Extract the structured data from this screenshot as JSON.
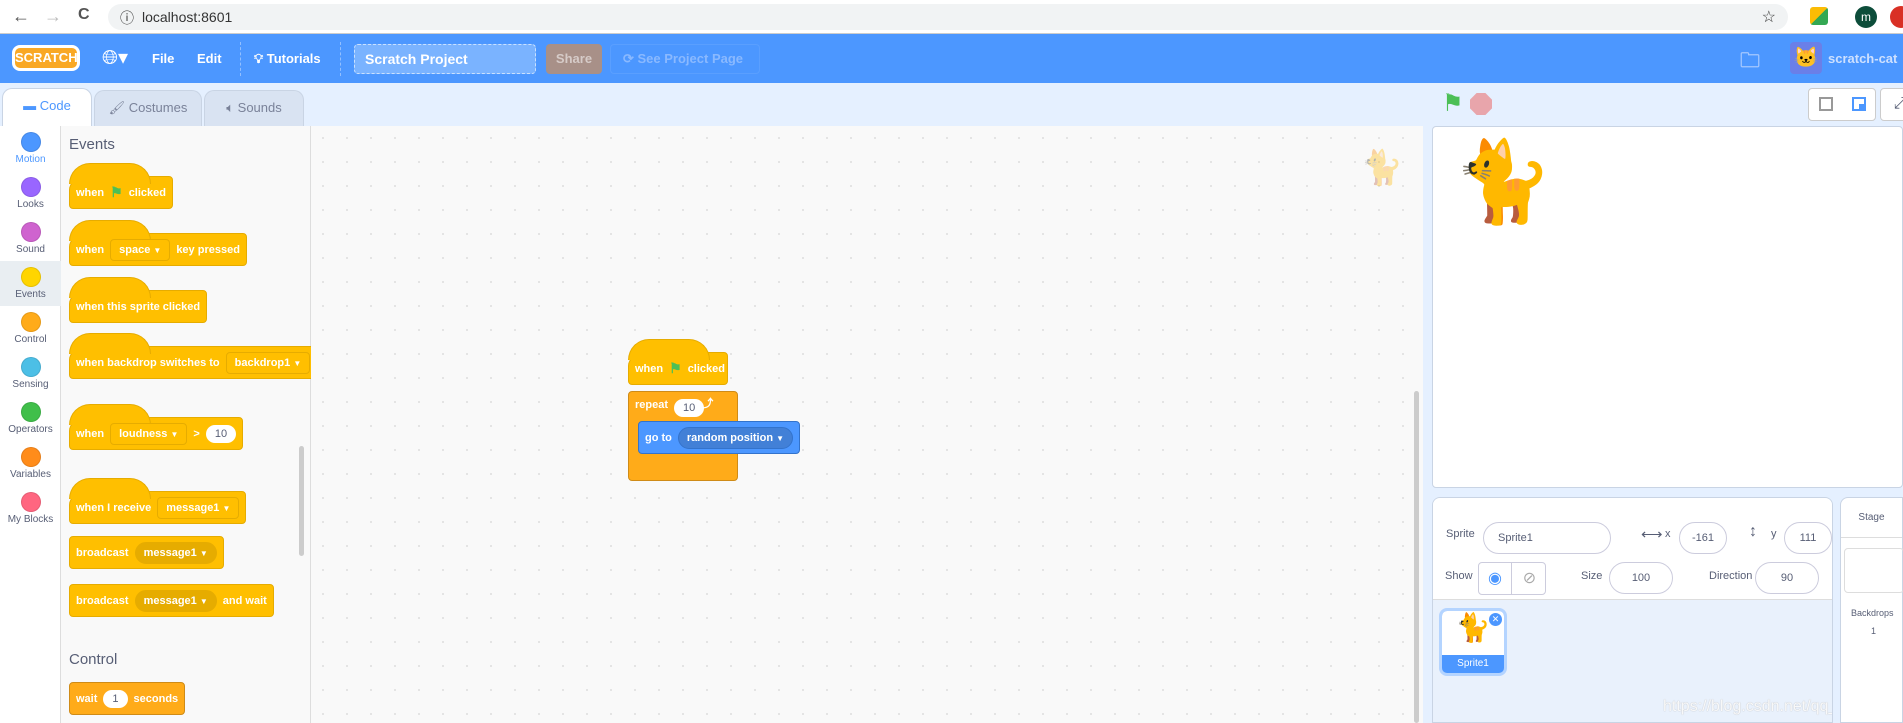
{
  "browser": {
    "url": "localhost:8601",
    "back": "←",
    "forward": "→",
    "reload": "C",
    "info": "ⓘ",
    "star": "☆",
    "profile": "m"
  },
  "menu": {
    "logo": "SCRATCH",
    "language_icon": "globe-icon",
    "file": "File",
    "edit": "Edit",
    "tutorials": "Tutorials",
    "project_title": "Scratch Project",
    "share": "Share",
    "see_project_page": "See Project Page",
    "username": "scratch-cat"
  },
  "tabs": [
    {
      "label": "Code",
      "active": true
    },
    {
      "label": "Costumes"
    },
    {
      "label": "Sounds"
    }
  ],
  "categories": [
    {
      "label": "Motion",
      "color": "#4c97ff"
    },
    {
      "label": "Looks",
      "color": "#9966ff"
    },
    {
      "label": "Sound",
      "color": "#cf63cf"
    },
    {
      "label": "Events",
      "color": "#ffd500",
      "selected": true
    },
    {
      "label": "Control",
      "color": "#ffab19"
    },
    {
      "label": "Sensing",
      "color": "#4cbfe6"
    },
    {
      "label": "Operators",
      "color": "#40bf4a"
    },
    {
      "label": "Variables",
      "color": "#ff8c1a"
    },
    {
      "label": "My Blocks",
      "color": "#ff6680"
    }
  ],
  "palette": {
    "events_heading": "Events",
    "control_heading": "Control",
    "b1": {
      "a": "when",
      "b": "clicked"
    },
    "b2": {
      "a": "when",
      "dd": "space",
      "b": "key pressed"
    },
    "b3": {
      "a": "when this sprite clicked"
    },
    "b4": {
      "a": "when backdrop switches to",
      "dd": "backdrop1"
    },
    "b5": {
      "a": "when",
      "dd": "loudness",
      "op": ">",
      "num": "10"
    },
    "b6": {
      "a": "when I receive",
      "dd": "message1"
    },
    "b7": {
      "a": "broadcast",
      "dd": "message1"
    },
    "b8": {
      "a": "broadcast",
      "dd": "message1",
      "b": "and wait"
    },
    "b9": {
      "a": "wait",
      "num": "1",
      "b": "seconds"
    }
  },
  "script": {
    "hat": {
      "a": "when",
      "b": "clicked"
    },
    "repeat": {
      "a": "repeat",
      "num": "10"
    },
    "goto": {
      "a": "go to",
      "dd": "random position"
    }
  },
  "sprite_info": {
    "sprite_label": "Sprite",
    "sprite_name": "Sprite1",
    "x_label": "x",
    "x": "-161",
    "y_label": "y",
    "y": "111",
    "show_label": "Show",
    "size_label": "Size",
    "size": "100",
    "direction_label": "Direction",
    "direction": "90"
  },
  "sprites": [
    {
      "name": "Sprite1",
      "selected": true
    }
  ],
  "stage_panel": {
    "title": "Stage",
    "backdrops_label": "Backdrops",
    "backdrops_count": "1"
  },
  "watermark": "https://blog.csdn.net/qq_38232598"
}
